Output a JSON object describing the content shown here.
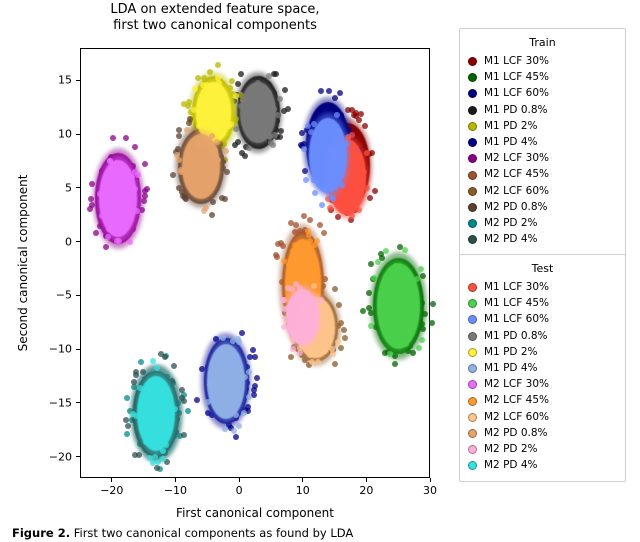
{
  "title": "LDA on extended feature space,\nfirst two canonical components",
  "xlabel": "First canonical component",
  "ylabel": "Second canonical component",
  "caption_bold": "Figure 2.",
  "caption_rest": " First two canonical components as found by LDA",
  "legend_train_title": "Train",
  "legend_test_title": "Test",
  "x_ticks": [
    -20,
    -10,
    0,
    10,
    20,
    30
  ],
  "y_ticks": [
    -20,
    -15,
    -10,
    -5,
    0,
    5,
    10,
    15
  ],
  "chart_data": {
    "type": "scatter",
    "title": "LDA on extended feature space, first two canonical components",
    "xlabel": "First canonical component",
    "ylabel": "Second canonical component",
    "xlim": [
      -25,
      30
    ],
    "ylim": [
      -22,
      18
    ],
    "grid": false,
    "legend_position": "outside-right",
    "clusters": [
      {
        "label": "M1 LCF 30%",
        "group": "Train",
        "color": "#8b0000",
        "cx": 17,
        "cy": 7,
        "rx": 3.5,
        "ry": 4.0,
        "n": 450
      },
      {
        "label": "M1 LCF 45%",
        "group": "Train",
        "color": "#006400",
        "cx": 25,
        "cy": -6,
        "rx": 4.0,
        "ry": 4.5,
        "n": 450
      },
      {
        "label": "M1 LCF 60%",
        "group": "Train",
        "color": "#000080",
        "cx": 14,
        "cy": 9,
        "rx": 3.5,
        "ry": 4.0,
        "n": 450
      },
      {
        "label": "M1 PD 0.8%",
        "group": "Train",
        "color": "#1a1a1a",
        "cx": 3,
        "cy": 12,
        "rx": 3.4,
        "ry": 3.4,
        "n": 450
      },
      {
        "label": "M1 PD 2%",
        "group": "Train",
        "color": "#b8b800",
        "cx": -4,
        "cy": 12,
        "rx": 3.4,
        "ry": 3.4,
        "n": 450
      },
      {
        "label": "M1 PD 4%",
        "group": "Train",
        "color": "#00008b",
        "cx": -2,
        "cy": -13,
        "rx": 3.5,
        "ry": 4.0,
        "n": 450
      },
      {
        "label": "M2 LCF 30%",
        "group": "Train",
        "color": "#8b008b",
        "cx": -19,
        "cy": 4,
        "rx": 3.6,
        "ry": 4.2,
        "n": 450
      },
      {
        "label": "M2 LCF 45%",
        "group": "Train",
        "color": "#a0522d",
        "cx": 10,
        "cy": -4,
        "rx": 3.3,
        "ry": 5.0,
        "n": 450
      },
      {
        "label": "M2 LCF 60%",
        "group": "Train",
        "color": "#8b5a2b",
        "cx": 12,
        "cy": -8,
        "rx": 3.6,
        "ry": 3.2,
        "n": 450
      },
      {
        "label": "M2 PD 0.8%",
        "group": "Train",
        "color": "#5c4033",
        "cx": -6,
        "cy": 7,
        "rx": 3.6,
        "ry": 3.5,
        "n": 450
      },
      {
        "label": "M2 PD 2%",
        "group": "Train",
        "color": "#008b8b",
        "cx": -13,
        "cy": -16,
        "rx": 3.6,
        "ry": 4.0,
        "n": 450
      },
      {
        "label": "M2 PD 4%",
        "group": "Train",
        "color": "#2f4f4f",
        "cx": -13,
        "cy": -16,
        "rx": 3.6,
        "ry": 4.0,
        "n": 450
      },
      {
        "label": "M1 LCF 30%",
        "group": "Test",
        "color": "#ff5040",
        "cx": 17,
        "cy": 6,
        "rx": 3.0,
        "ry": 3.5,
        "n": 200
      },
      {
        "label": "M1 LCF 45%",
        "group": "Test",
        "color": "#4bd14b",
        "cx": 25,
        "cy": -6,
        "rx": 3.4,
        "ry": 4.0,
        "n": 200
      },
      {
        "label": "M1 LCF 60%",
        "group": "Test",
        "color": "#6b8eff",
        "cx": 14,
        "cy": 8,
        "rx": 3.0,
        "ry": 3.5,
        "n": 200
      },
      {
        "label": "M1 PD 0.8%",
        "group": "Test",
        "color": "#7a7a7a",
        "cx": 3,
        "cy": 12,
        "rx": 2.8,
        "ry": 2.8,
        "n": 200
      },
      {
        "label": "M1 PD 2%",
        "group": "Test",
        "color": "#fff23a",
        "cx": -4,
        "cy": 12,
        "rx": 2.8,
        "ry": 2.8,
        "n": 200
      },
      {
        "label": "M1 PD 4%",
        "group": "Test",
        "color": "#8fb1e6",
        "cx": -2,
        "cy": -13,
        "rx": 3.0,
        "ry": 3.5,
        "n": 200
      },
      {
        "label": "M2 LCF 30%",
        "group": "Test",
        "color": "#e96bff",
        "cx": -19,
        "cy": 4,
        "rx": 3.0,
        "ry": 3.6,
        "n": 200
      },
      {
        "label": "M2 LCF 45%",
        "group": "Test",
        "color": "#ff9a2e",
        "cx": 10,
        "cy": -4,
        "rx": 2.8,
        "ry": 4.2,
        "n": 200
      },
      {
        "label": "M2 LCF 60%",
        "group": "Test",
        "color": "#ffc58c",
        "cx": 12,
        "cy": -8,
        "rx": 3.0,
        "ry": 2.8,
        "n": 200
      },
      {
        "label": "M2 PD 0.8%",
        "group": "Test",
        "color": "#e6a46b",
        "cx": -6,
        "cy": 7,
        "rx": 3.0,
        "ry": 3.0,
        "n": 200
      },
      {
        "label": "M2 PD 2%",
        "group": "Test",
        "color": "#ffb0d8",
        "cx": 10,
        "cy": -7,
        "rx": 2.6,
        "ry": 2.6,
        "n": 200
      },
      {
        "label": "M2 PD 4%",
        "group": "Test",
        "color": "#35e1df",
        "cx": -13,
        "cy": -16,
        "rx": 3.0,
        "ry": 3.5,
        "n": 200
      }
    ]
  }
}
